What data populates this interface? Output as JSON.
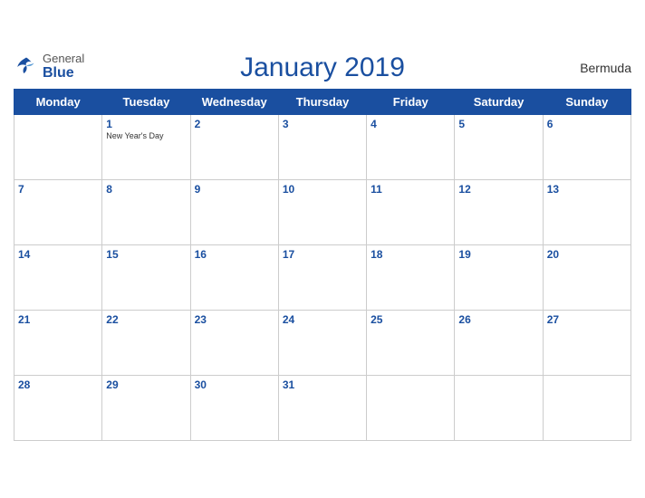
{
  "header": {
    "logo_general": "General",
    "logo_blue": "Blue",
    "title": "January 2019",
    "region": "Bermuda"
  },
  "days_of_week": [
    "Monday",
    "Tuesday",
    "Wednesday",
    "Thursday",
    "Friday",
    "Saturday",
    "Sunday"
  ],
  "weeks": [
    [
      {
        "day": "",
        "holiday": ""
      },
      {
        "day": "1",
        "holiday": "New Year's Day"
      },
      {
        "day": "2",
        "holiday": ""
      },
      {
        "day": "3",
        "holiday": ""
      },
      {
        "day": "4",
        "holiday": ""
      },
      {
        "day": "5",
        "holiday": ""
      },
      {
        "day": "6",
        "holiday": ""
      }
    ],
    [
      {
        "day": "7",
        "holiday": ""
      },
      {
        "day": "8",
        "holiday": ""
      },
      {
        "day": "9",
        "holiday": ""
      },
      {
        "day": "10",
        "holiday": ""
      },
      {
        "day": "11",
        "holiday": ""
      },
      {
        "day": "12",
        "holiday": ""
      },
      {
        "day": "13",
        "holiday": ""
      }
    ],
    [
      {
        "day": "14",
        "holiday": ""
      },
      {
        "day": "15",
        "holiday": ""
      },
      {
        "day": "16",
        "holiday": ""
      },
      {
        "day": "17",
        "holiday": ""
      },
      {
        "day": "18",
        "holiday": ""
      },
      {
        "day": "19",
        "holiday": ""
      },
      {
        "day": "20",
        "holiday": ""
      }
    ],
    [
      {
        "day": "21",
        "holiday": ""
      },
      {
        "day": "22",
        "holiday": ""
      },
      {
        "day": "23",
        "holiday": ""
      },
      {
        "day": "24",
        "holiday": ""
      },
      {
        "day": "25",
        "holiday": ""
      },
      {
        "day": "26",
        "holiday": ""
      },
      {
        "day": "27",
        "holiday": ""
      }
    ],
    [
      {
        "day": "28",
        "holiday": ""
      },
      {
        "day": "29",
        "holiday": ""
      },
      {
        "day": "30",
        "holiday": ""
      },
      {
        "day": "31",
        "holiday": ""
      },
      {
        "day": "",
        "holiday": ""
      },
      {
        "day": "",
        "holiday": ""
      },
      {
        "day": "",
        "holiday": ""
      }
    ]
  ]
}
